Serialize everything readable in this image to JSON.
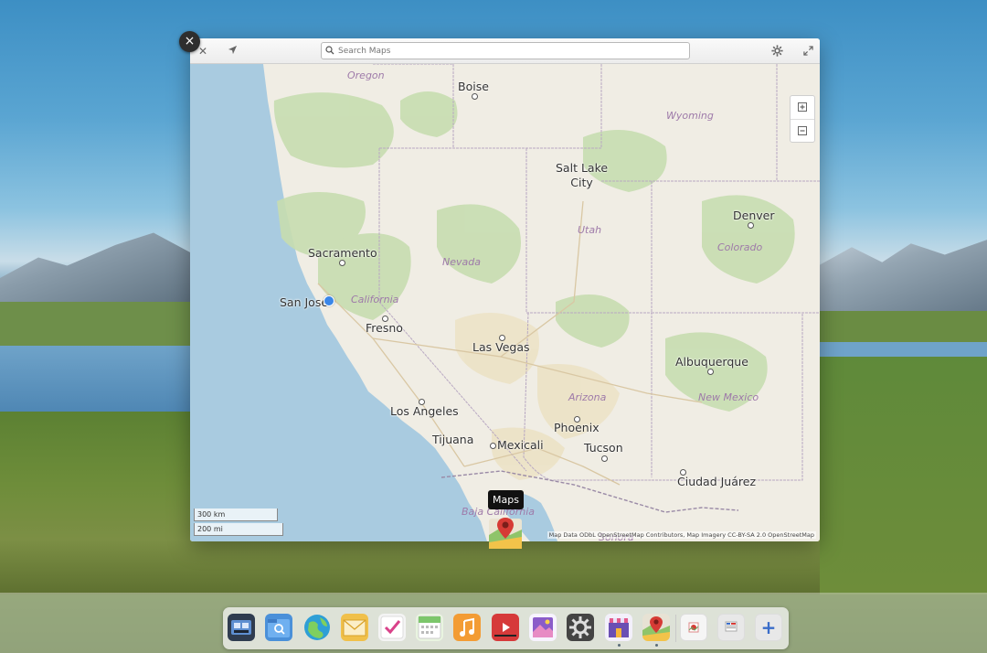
{
  "window": {
    "search_placeholder": "Search Maps",
    "search_value": "",
    "close_glyph": "×",
    "icons": [
      "close-icon",
      "location-arrow-icon",
      "search-icon",
      "gear-icon",
      "fullscreen-icon"
    ]
  },
  "map": {
    "states": [
      "Oregon",
      "Wyoming",
      "Utah",
      "Nevada",
      "California",
      "Colorado",
      "Arizona",
      "New Mexico",
      "Baja California",
      "Sonora"
    ],
    "cities": [
      "Boise",
      "Salt Lake City",
      "Denver",
      "Sacramento",
      "San Jose",
      "Fresno",
      "Las Vegas",
      "Albuquerque",
      "Los Angeles",
      "Tijuana",
      "Mexicali",
      "Phoenix",
      "Tucson",
      "Ciudad Juárez"
    ],
    "salt_lake_lines": [
      "Salt Lake",
      "City"
    ],
    "scale_km": "300 km",
    "scale_mi": "200 mi",
    "attribution": "Map Data ODbL OpenStreetMap Contributors, Map Imagery CC-BY-SA 2.0 OpenStreetMap",
    "zoom_in": "+",
    "zoom_out": "−"
  },
  "tooltip": "Maps",
  "dock": {
    "apps": [
      {
        "name": "Multitasking View",
        "color": "#2f3c4f"
      },
      {
        "name": "Files",
        "color": "#4a90d9"
      },
      {
        "name": "Web Browser",
        "color": "#2e9fd6"
      },
      {
        "name": "Mail",
        "color": "#f0c04a"
      },
      {
        "name": "Tasks",
        "color": "#e9e9e9"
      },
      {
        "name": "Calendar",
        "color": "#7cc66b"
      },
      {
        "name": "Music",
        "color": "#f39c34"
      },
      {
        "name": "Videos",
        "color": "#d63a3a"
      },
      {
        "name": "Photos",
        "color": "#8a5cc9"
      },
      {
        "name": "System Settings",
        "color": "#444"
      },
      {
        "name": "AppCenter",
        "color": "#6a4fb3"
      },
      {
        "name": "Maps",
        "color": "#e7e2d4"
      },
      {
        "name": "Photo Viewer",
        "color": "#f5f5f5"
      },
      {
        "name": "Screenshot",
        "color": "#e8e8e8"
      },
      {
        "name": "Add",
        "color": "#e8e8e8"
      }
    ],
    "add_glyph": "+"
  }
}
